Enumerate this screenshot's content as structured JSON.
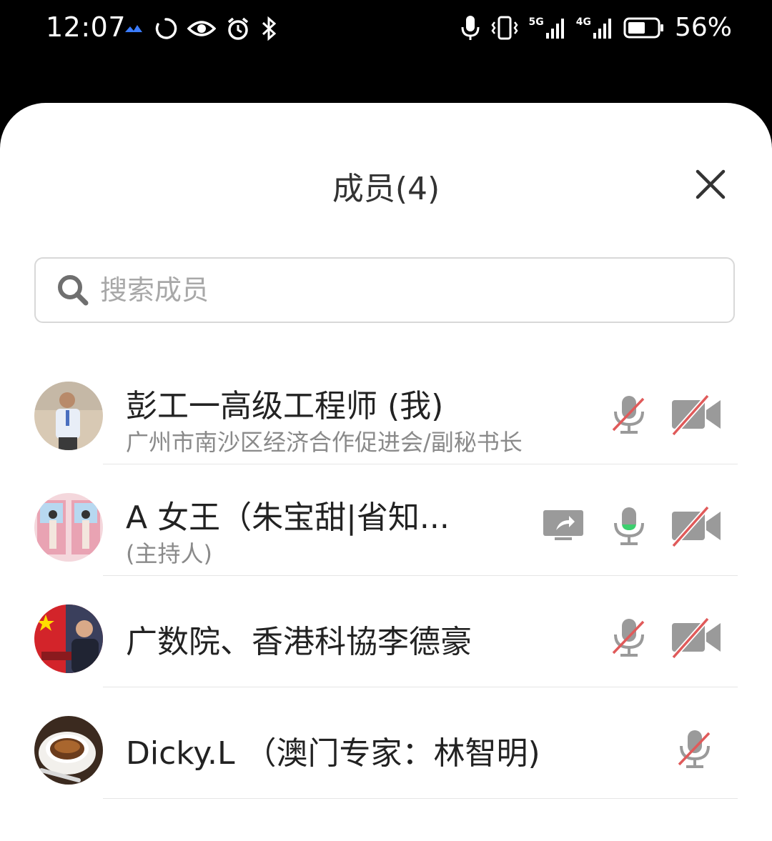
{
  "status_bar": {
    "time": "12:07",
    "battery_percent": "56%",
    "network_1": "5G",
    "network_2": "4G",
    "left_icons": [
      "lark-icon",
      "sync-circle-icon",
      "eye-icon",
      "alarm-icon",
      "bluetooth-icon"
    ],
    "right_icons": [
      "microphone-icon",
      "vibrate-icon",
      "signal-5g-icon",
      "signal-4g-icon",
      "battery-icon"
    ]
  },
  "panel": {
    "title": "成员(4)",
    "close_icon": "close-icon"
  },
  "search": {
    "placeholder": "搜索成员",
    "value": ""
  },
  "members": [
    {
      "name": "彭工一高级工程师 (我)",
      "subtitle": "广州市南沙区经济合作促进会/副秘书长",
      "mic": "muted",
      "camera": "off",
      "sharing": false
    },
    {
      "name": "A  女王（朱宝甜|省知...",
      "subtitle": "(主持人)",
      "mic": "active",
      "camera": "off",
      "sharing": true
    },
    {
      "name": "广数院、香港科協李德豪",
      "subtitle": "",
      "mic": "muted",
      "camera": "off",
      "sharing": false
    },
    {
      "name": "Dicky.L （澳门专家：林智明)",
      "subtitle": "",
      "mic": "muted",
      "camera": "none",
      "sharing": false
    }
  ],
  "colors": {
    "muted_slash": "#e05a5a",
    "icon_gray": "#9a9a9a",
    "mic_active": "#3ccf6e"
  }
}
